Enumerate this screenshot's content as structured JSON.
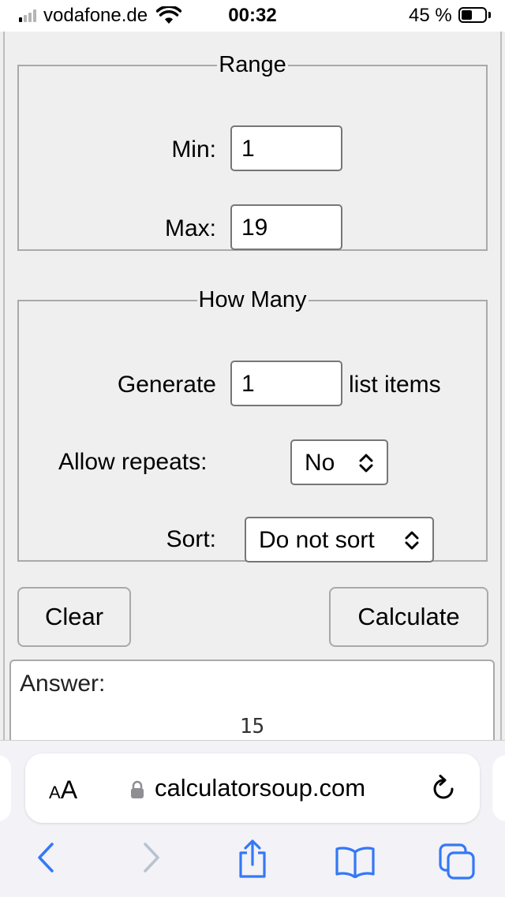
{
  "status_bar": {
    "carrier": "vodafone.de",
    "time": "00:32",
    "battery_percent": "45 %",
    "battery_level": 0.45,
    "signal_bars_active": 1,
    "signal_bars_total": 4
  },
  "range": {
    "legend": "Range",
    "min_label": "Min:",
    "min_value": "1",
    "max_label": "Max:",
    "max_value": "19"
  },
  "how_many": {
    "legend": "How Many",
    "generate_label": "Generate",
    "generate_value": "1",
    "generate_suffix": "list items",
    "repeats_label": "Allow repeats:",
    "repeats_value": "No",
    "sort_label": "Sort:",
    "sort_value": "Do not sort"
  },
  "buttons": {
    "clear": "Clear",
    "calculate": "Calculate"
  },
  "answer": {
    "label": "Answer:",
    "value": "15"
  },
  "browser": {
    "text_size_small": "A",
    "text_size_large": "A",
    "url": "calculatorsoup.com",
    "accent_color": "#3478f6"
  },
  "icons": [
    "wifi-icon",
    "lock-icon",
    "reload-icon",
    "back-icon",
    "forward-icon",
    "share-icon",
    "bookmarks-icon",
    "tabs-icon",
    "chevron-updown-icon"
  ]
}
